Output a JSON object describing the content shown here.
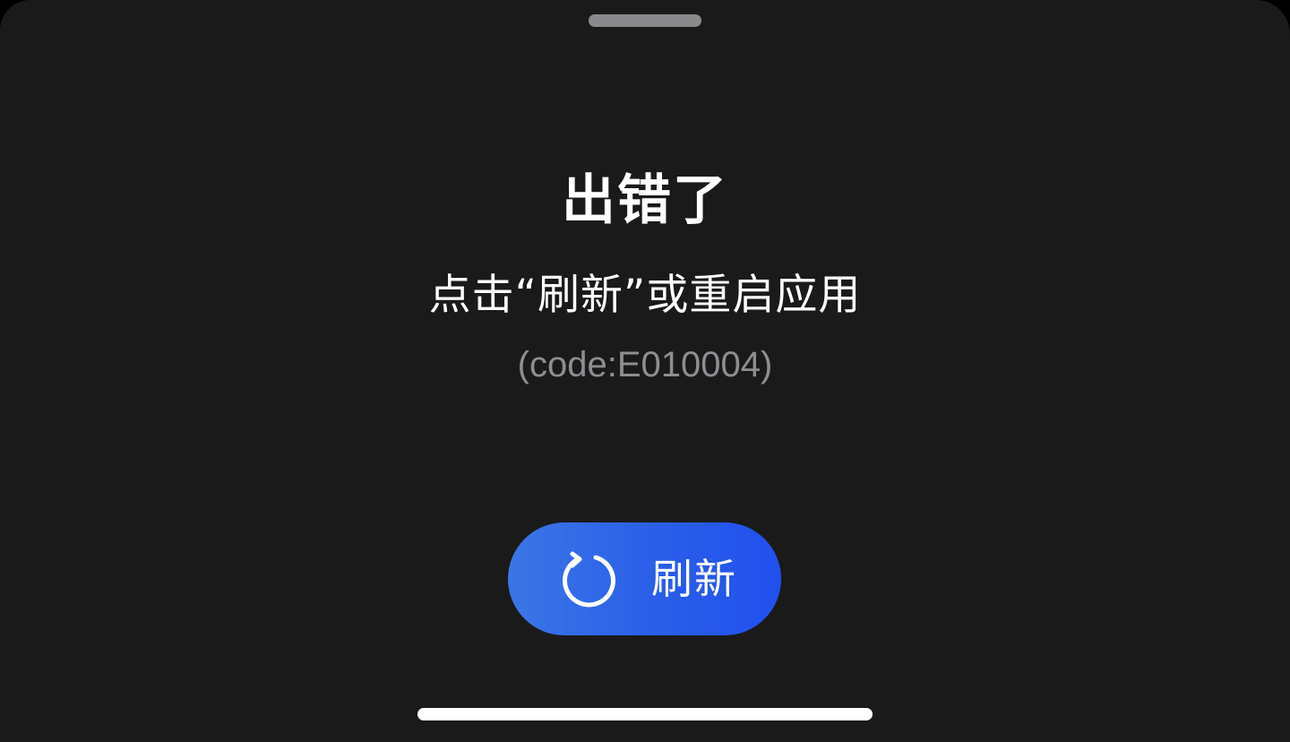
{
  "error": {
    "title": "出错了",
    "message": "点击“刷新”或重启应用",
    "code": "(code:E010004)"
  },
  "actions": {
    "refresh_label": "刷新",
    "refresh_icon": "refresh-icon"
  },
  "colors": {
    "background": "#1a1a1b",
    "accent": "#2a5ee9",
    "secondary_text": "#8e8e93"
  }
}
